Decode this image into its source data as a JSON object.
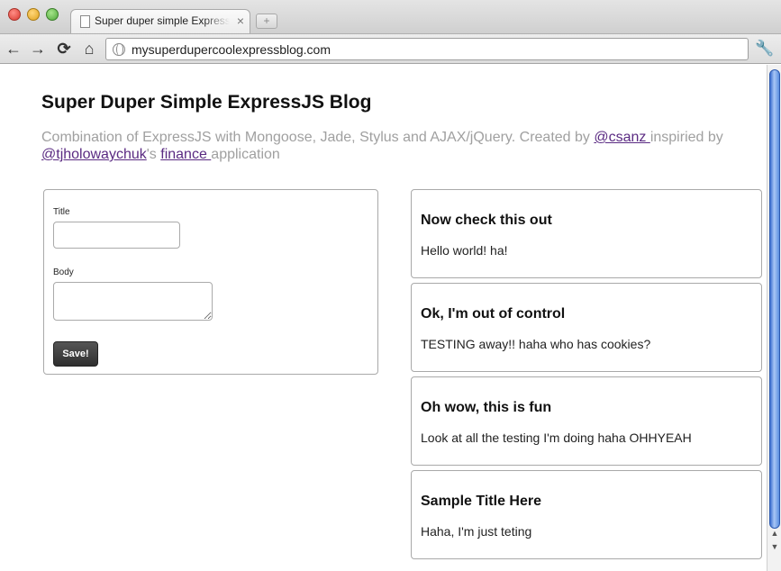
{
  "browser": {
    "tab_title": "Super duper simple ExpressJS",
    "tab_close": "×",
    "new_tab": "+",
    "url": "mysuperdupercoolexpressblog.com",
    "icons": {
      "back": "←",
      "forward": "→",
      "reload": "⟳",
      "home": "⌂",
      "wrench": "🔧"
    }
  },
  "page": {
    "title": "Super Duper Simple ExpressJS Blog",
    "subtitle": {
      "text1": "Combination of ExpressJS with Mongoose, Jade, Stylus and AJAX/jQuery. Created by ",
      "link1": "@csanz ",
      "text2": "inspiried by ",
      "link2": "@tjholowaychuk",
      "text3": "'s ",
      "link3": "finance ",
      "text4": "application"
    },
    "form": {
      "title_label": "Title",
      "body_label": "Body",
      "title_value": "",
      "body_value": "",
      "save_label": "Save!"
    },
    "posts": [
      {
        "title": "Now check this out",
        "body": "Hello world! ha!"
      },
      {
        "title": "Ok, I'm out of control",
        "body": "TESTING away!! haha who has cookies?"
      },
      {
        "title": "Oh wow, this is fun",
        "body": "Look at all the testing I'm doing haha OHHYEAH"
      },
      {
        "title": "Sample Title Here",
        "body": "Haha, I'm just teting"
      }
    ]
  }
}
